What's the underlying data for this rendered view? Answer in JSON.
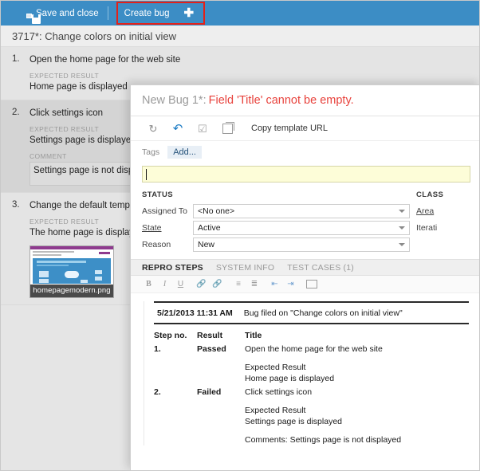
{
  "toolbar": {
    "save_label": "",
    "save_close_label": "Save and close",
    "create_bug_label": "Create bug",
    "plus_label": "✚",
    "bg_color": "#3c8dc5",
    "highlight_color": "#e32119"
  },
  "page": {
    "title": "3717*: Change colors on initial view"
  },
  "steps": [
    {
      "number": "1.",
      "title": "Open the home page for the web site",
      "expected_label": "EXPECTED RESULT",
      "expected_text": "Home page is displayed",
      "comment_label": "",
      "comment_text": ""
    },
    {
      "number": "2.",
      "title": "Click settings icon",
      "expected_label": "EXPECTED RESULT",
      "expected_text": "Settings page is displayed",
      "comment_label": "COMMENT",
      "comment_text": "Settings page is not displ"
    },
    {
      "number": "3.",
      "title": "Change the default templ",
      "expected_label": "EXPECTED RESULT",
      "expected_text": "The home page is display",
      "attachment_name": "homepagemodern.png"
    }
  ],
  "dialog": {
    "title": "New Bug 1*:",
    "error": "Field 'Title' cannot be empty.",
    "error_color": "#e8423c",
    "tools": {
      "refresh_icon": "refresh-icon",
      "undo_icon": "undo-icon",
      "revert_icon": "revert-icon",
      "copy_icon": "copy-icon",
      "copy_template_url_label": "Copy template URL"
    },
    "tags": {
      "label": "Tags",
      "add_label": "Add..."
    },
    "title_field": {
      "value": "",
      "placeholder": ""
    },
    "status": {
      "section_label": "STATUS",
      "fields": [
        {
          "label": "Assigned To",
          "value": "<No one>"
        },
        {
          "label": "State",
          "value": "Active"
        },
        {
          "label": "Reason",
          "value": "New"
        }
      ]
    },
    "classification": {
      "section_label": "CLASS",
      "fields": [
        {
          "label": "Area"
        },
        {
          "label": "Iterati"
        }
      ]
    },
    "tabs": [
      {
        "label": "REPRO STEPS",
        "active": true
      },
      {
        "label": "SYSTEM INFO",
        "active": false
      },
      {
        "label": "TEST CASES (1)",
        "active": false
      }
    ],
    "editor_toolbar": [
      "bold-icon",
      "italic-icon",
      "underline-icon",
      "insert-link-icon",
      "remove-link-icon",
      "bullet-list-icon",
      "numbered-list-icon",
      "outdent-icon",
      "indent-icon",
      "insert-image-icon"
    ],
    "repro": {
      "filed_date": "5/21/2013 11:31 AM",
      "filed_text": "Bug filed on \"Change colors on initial view\"",
      "columns": [
        "Step no.",
        "Result",
        "Title"
      ],
      "rows": [
        {
          "no": "1.",
          "result": "Passed",
          "result_state": "pass",
          "title": "Open the home page for the web site",
          "expected_label": "Expected Result",
          "expected_text": "Home page is displayed",
          "comment": ""
        },
        {
          "no": "2.",
          "result": "Failed",
          "result_state": "fail",
          "title": "Click settings icon",
          "expected_label": "Expected Result",
          "expected_text": "Settings page is displayed",
          "comment": "Comments: Settings page is not displayed"
        }
      ]
    }
  }
}
